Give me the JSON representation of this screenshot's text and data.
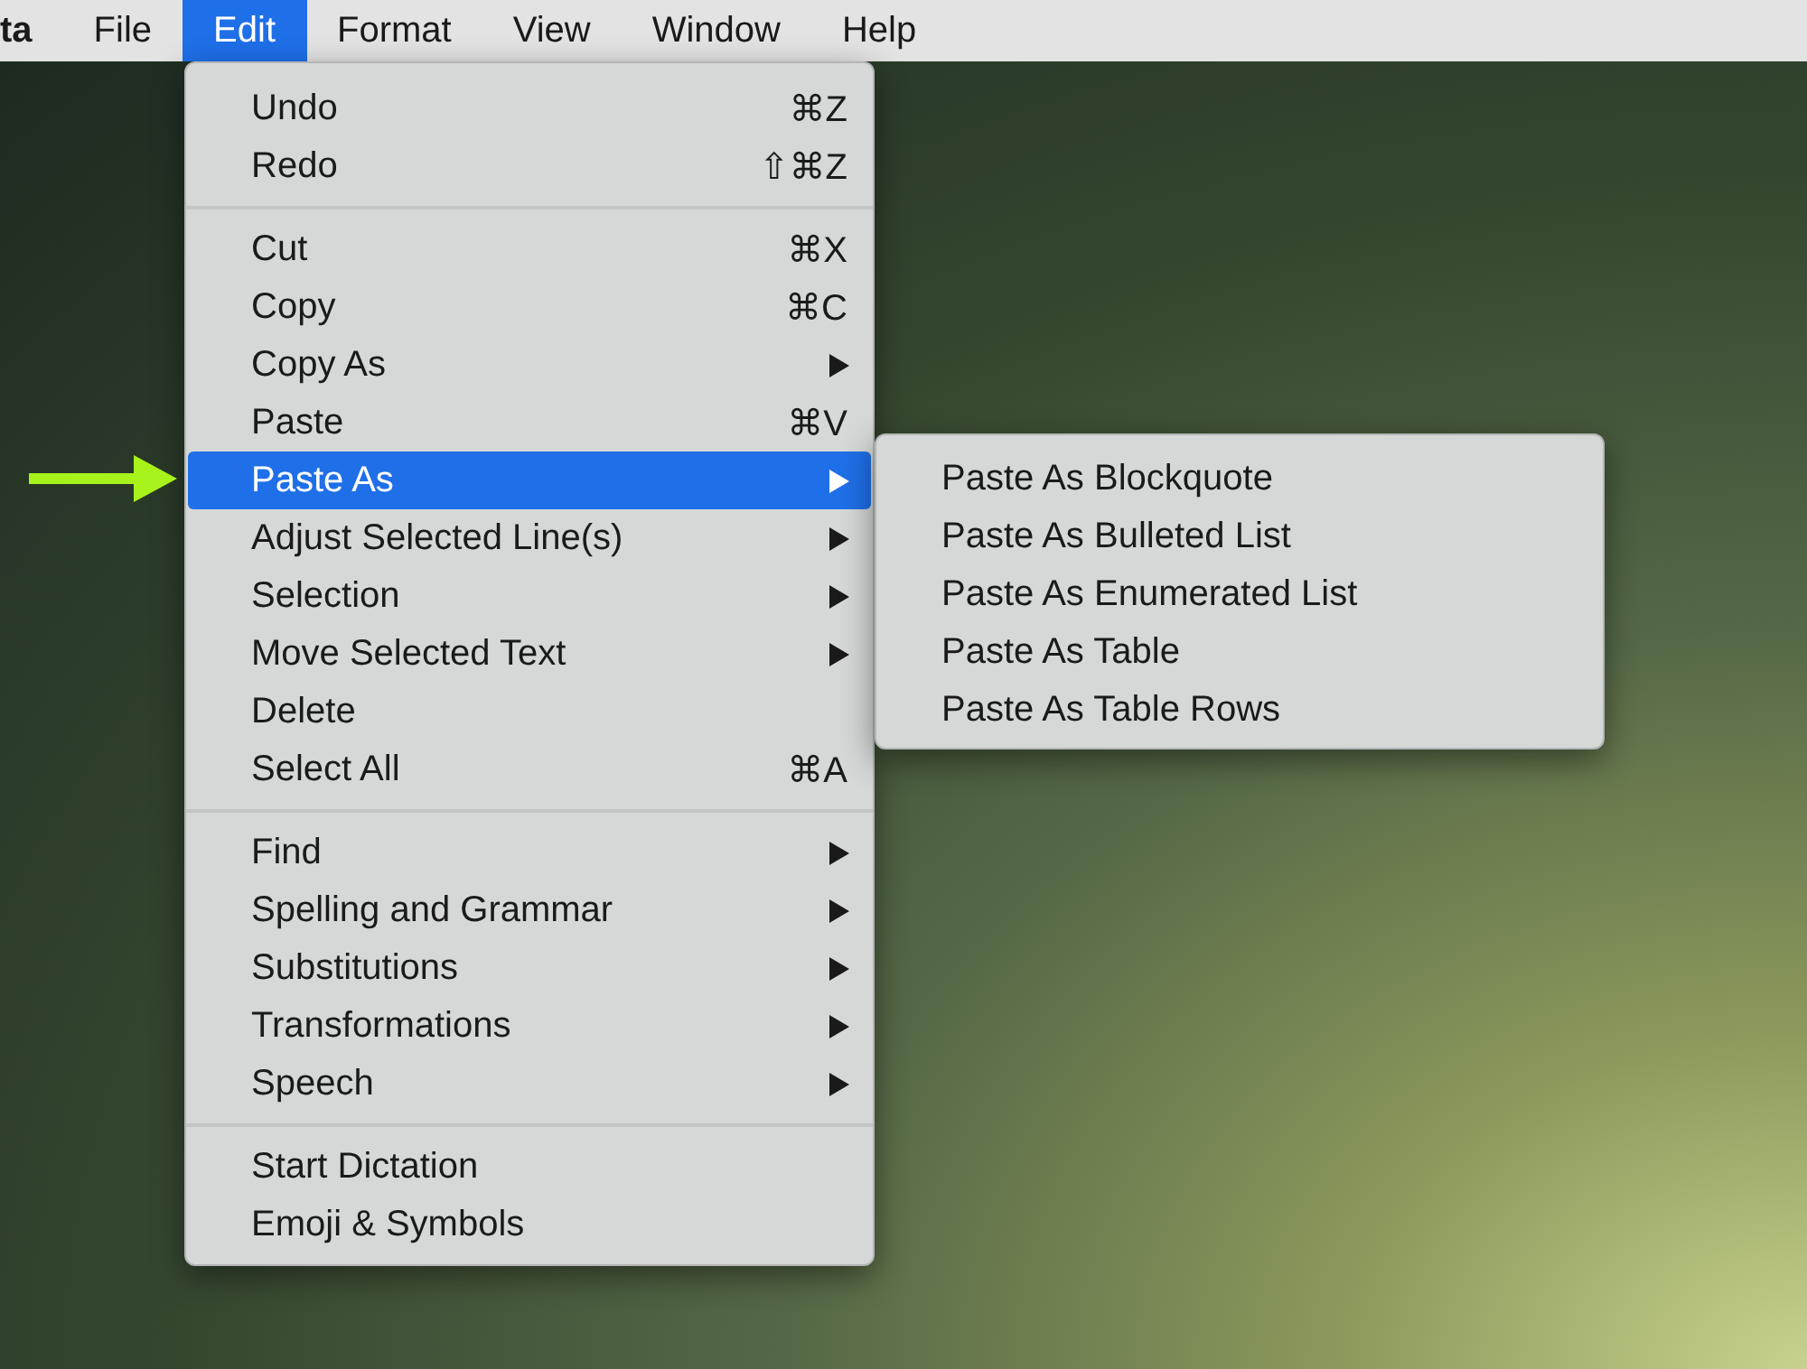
{
  "menubar": {
    "items": [
      {
        "label": "ta",
        "kind": "app"
      },
      {
        "label": "File",
        "kind": "menu",
        "selected": false
      },
      {
        "label": "Edit",
        "kind": "menu",
        "selected": true
      },
      {
        "label": "Format",
        "kind": "menu",
        "selected": false
      },
      {
        "label": "View",
        "kind": "menu",
        "selected": false
      },
      {
        "label": "Window",
        "kind": "menu",
        "selected": false
      },
      {
        "label": "Help",
        "kind": "menu",
        "selected": false
      }
    ]
  },
  "edit_menu": {
    "sections": [
      [
        {
          "label": "Undo",
          "shortcut": "⌘Z",
          "has_submenu": false,
          "selected": false
        },
        {
          "label": "Redo",
          "shortcut": "⇧⌘Z",
          "has_submenu": false,
          "selected": false
        }
      ],
      [
        {
          "label": "Cut",
          "shortcut": "⌘X",
          "has_submenu": false,
          "selected": false
        },
        {
          "label": "Copy",
          "shortcut": "⌘C",
          "has_submenu": false,
          "selected": false
        },
        {
          "label": "Copy As",
          "has_submenu": true,
          "selected": false
        },
        {
          "label": "Paste",
          "shortcut": "⌘V",
          "has_submenu": false,
          "selected": false
        },
        {
          "label": "Paste As",
          "has_submenu": true,
          "selected": true
        },
        {
          "label": "Adjust Selected Line(s)",
          "has_submenu": true,
          "selected": false
        },
        {
          "label": "Selection",
          "has_submenu": true,
          "selected": false
        },
        {
          "label": "Move Selected Text",
          "has_submenu": true,
          "selected": false
        },
        {
          "label": "Delete",
          "has_submenu": false,
          "selected": false
        },
        {
          "label": "Select All",
          "shortcut": "⌘A",
          "has_submenu": false,
          "selected": false
        }
      ],
      [
        {
          "label": "Find",
          "has_submenu": true,
          "selected": false
        },
        {
          "label": "Spelling and Grammar",
          "has_submenu": true,
          "selected": false
        },
        {
          "label": "Substitutions",
          "has_submenu": true,
          "selected": false
        },
        {
          "label": "Transformations",
          "has_submenu": true,
          "selected": false
        },
        {
          "label": "Speech",
          "has_submenu": true,
          "selected": false
        }
      ],
      [
        {
          "label": "Start Dictation",
          "has_submenu": false,
          "selected": false
        },
        {
          "label": "Emoji & Symbols",
          "has_submenu": false,
          "selected": false
        }
      ]
    ]
  },
  "paste_as_submenu": {
    "items": [
      {
        "label": "Paste As Blockquote",
        "selected": false
      },
      {
        "label": "Paste As Bulleted List",
        "selected": false
      },
      {
        "label": "Paste As Enumerated List",
        "selected": false
      },
      {
        "label": "Paste As Table",
        "selected": false
      },
      {
        "label": "Paste As Table Rows",
        "selected": false
      }
    ]
  }
}
